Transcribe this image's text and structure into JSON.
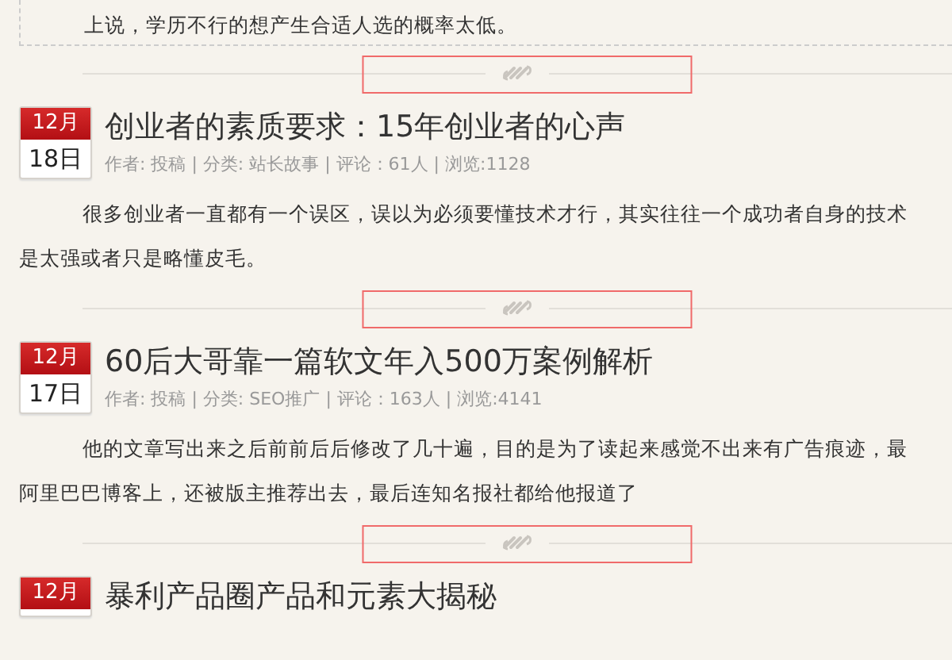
{
  "items": [
    {
      "kind": "excerpt_end",
      "lines": [
        "上说，学历不行的想产生合适人选的概率太低。"
      ]
    },
    {
      "kind": "divider",
      "highlighted": true
    },
    {
      "kind": "article",
      "month": "12月",
      "day": "18日",
      "title": "创业者的素质要求：15年创业者的心声",
      "meta": "作者: 投稿 | 分类: 站长故事 | 评论：61人 | 浏览:1128",
      "lines": [
        "很多创业者一直都有一个误区，误以为必须要懂技术才行，其实往往一个成功者自身的技术",
        "是太强或者只是略懂皮毛。"
      ]
    },
    {
      "kind": "divider",
      "highlighted": true
    },
    {
      "kind": "article",
      "month": "12月",
      "day": "17日",
      "title": "60后大哥靠一篇软文年入500万案例解析",
      "meta": "作者: 投稿 | 分类: SEO推广 | 评论：163人 | 浏览:4141",
      "lines": [
        "他的文章写出来之后前前后后修改了几十遍，目的是为了读起来感觉不出来有广告痕迹，最",
        "阿里巴巴博客上，还被版主推荐出去，最后连知名报社都给他报道了"
      ]
    },
    {
      "kind": "divider",
      "highlighted": true
    },
    {
      "kind": "article",
      "month": "12月",
      "title": "暴利产品圈产品和元素大揭秘"
    }
  ]
}
